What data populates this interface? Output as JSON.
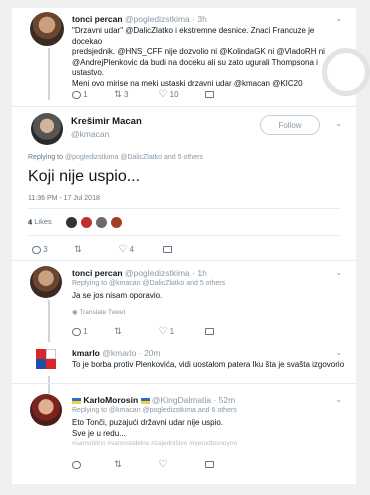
{
  "tweet1": {
    "name": "tonci percan",
    "handle": "@pogledizstkima",
    "time": "· 3h",
    "line1": "\"Drzavni udar\" @DalicZlatko i ekstremne desnice. Znaci Francuze je docekao",
    "line2": "predsjednik. @HNS_CFF nije dozvolio ni @KolindaGK ni @VladoRH ni",
    "line3": "@AndrejPlenkovic da budi na doceku ali su zato ugurali Thompsona i ustastvo.",
    "line4": "Meni ovo mirise na meki ustaski drzavni udar @kmacan @KIC20",
    "reply_count": "1",
    "rt_count": "3",
    "like_count": "10"
  },
  "tweet2": {
    "name": "Krešimir Macan",
    "handle": "@kmacan",
    "follow_label": "Follow",
    "replying_prefix": "Replying to",
    "replying_to": "@pogledizstkima @DalicZlatko and 5 others",
    "text": "Koji nije uspio...",
    "timestamp": "11:36 PM - 17 Jul 2018",
    "likes_count": "4",
    "likes_label": "Likes",
    "reply_count": "3",
    "like_count": "4"
  },
  "tweet3": {
    "name": "tonci percan",
    "handle": "@pogledizstkima",
    "time": "· 1h",
    "replying": "Replying to @kmacan @DalicZlatko and 5 others",
    "text": "Ja se jos nisam oporavio.",
    "translate": "Translate Tweet",
    "reply_count": "1",
    "like_count": "1"
  },
  "tweet4": {
    "name": "kmarlo",
    "handle": "@kmarlo",
    "time": "· 20m",
    "text": "To je borba protiv Plenkovića, vidi uostalom patera Iku šta je svašta izgovorio"
  },
  "tweet5": {
    "name": "KarloMorosin",
    "handle": "@KingDalmatia",
    "time": "· 52m",
    "replying": "Replying to @kmacan @pogledizstkima and 6 others",
    "line1": "Eto Tonči, puzajući državni udar nije uspio.",
    "line2": "Sve je u redu...",
    "line3": "#samobitno #samostabilno #zajedništvo #njerudtosnoyno"
  },
  "icons": [
    "reply-icon",
    "retweet-icon",
    "heart-icon",
    "message-icon",
    "chevron-down-icon"
  ]
}
